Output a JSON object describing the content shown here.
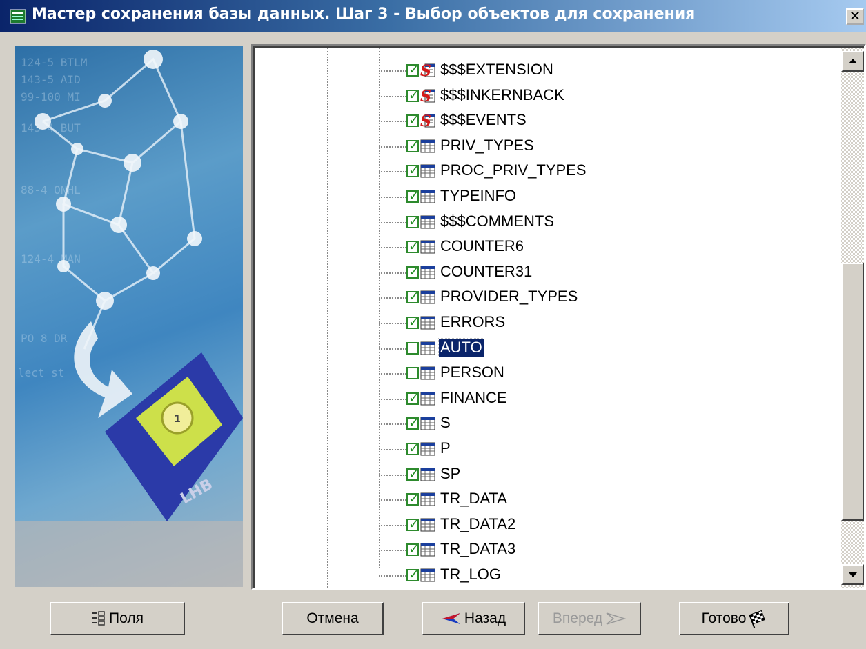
{
  "window": {
    "title": "Мастер сохранения базы данных. Шаг 3 - Выбор объектов для сохранения",
    "close_label": "✕"
  },
  "tree": {
    "items": [
      {
        "label": "$$$EXTENSION",
        "checked": true,
        "icon": "system-table-icon"
      },
      {
        "label": "$$$INKERNBACK",
        "checked": true,
        "icon": "system-table-icon"
      },
      {
        "label": "$$$EVENTS",
        "checked": true,
        "icon": "system-table-icon"
      },
      {
        "label": "PRIV_TYPES",
        "checked": true,
        "icon": "table-icon"
      },
      {
        "label": "PROC_PRIV_TYPES",
        "checked": true,
        "icon": "table-icon"
      },
      {
        "label": "TYPEINFO",
        "checked": true,
        "icon": "table-icon"
      },
      {
        "label": "$$$COMMENTS",
        "checked": true,
        "icon": "table-icon"
      },
      {
        "label": "COUNTER6",
        "checked": true,
        "icon": "table-icon"
      },
      {
        "label": "COUNTER31",
        "checked": true,
        "icon": "table-icon"
      },
      {
        "label": "PROVIDER_TYPES",
        "checked": true,
        "icon": "table-icon"
      },
      {
        "label": "ERRORS",
        "checked": true,
        "icon": "table-icon"
      },
      {
        "label": "AUTO",
        "checked": false,
        "icon": "table-icon",
        "selected": true
      },
      {
        "label": "PERSON",
        "checked": false,
        "icon": "table-icon"
      },
      {
        "label": "FINANCE",
        "checked": true,
        "icon": "table-icon"
      },
      {
        "label": "S",
        "checked": true,
        "icon": "table-icon"
      },
      {
        "label": "P",
        "checked": true,
        "icon": "table-icon"
      },
      {
        "label": "SP",
        "checked": true,
        "icon": "table-icon"
      },
      {
        "label": "TR_DATA",
        "checked": true,
        "icon": "table-icon"
      },
      {
        "label": "TR_DATA2",
        "checked": true,
        "icon": "table-icon"
      },
      {
        "label": "TR_DATA3",
        "checked": true,
        "icon": "table-icon"
      },
      {
        "label": "TR_LOG",
        "checked": true,
        "icon": "table-icon"
      }
    ]
  },
  "buttons": {
    "fields": "Поля",
    "cancel": "Отмена",
    "back": "Назад",
    "next": "Вперед",
    "finish": "Готово"
  },
  "colors": {
    "selection": "#0a246a",
    "checkbox": "#1f8c1f",
    "dialog_bg": "#d4d0c8"
  }
}
